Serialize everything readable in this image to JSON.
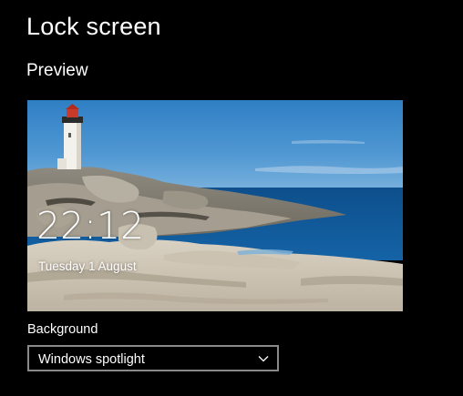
{
  "page": {
    "title": "Lock screen"
  },
  "preview": {
    "heading": "Preview",
    "lock_time": "22:12",
    "lock_date": "Tuesday 1 August",
    "image_subject": "lighthouse-on-rocky-coast"
  },
  "background": {
    "label": "Background",
    "selected_value": "Windows spotlight",
    "icon": "chevron-down-icon"
  },
  "colors": {
    "page_background": "#000000",
    "text": "#ffffff",
    "dropdown_border": "#8a8a8a"
  }
}
